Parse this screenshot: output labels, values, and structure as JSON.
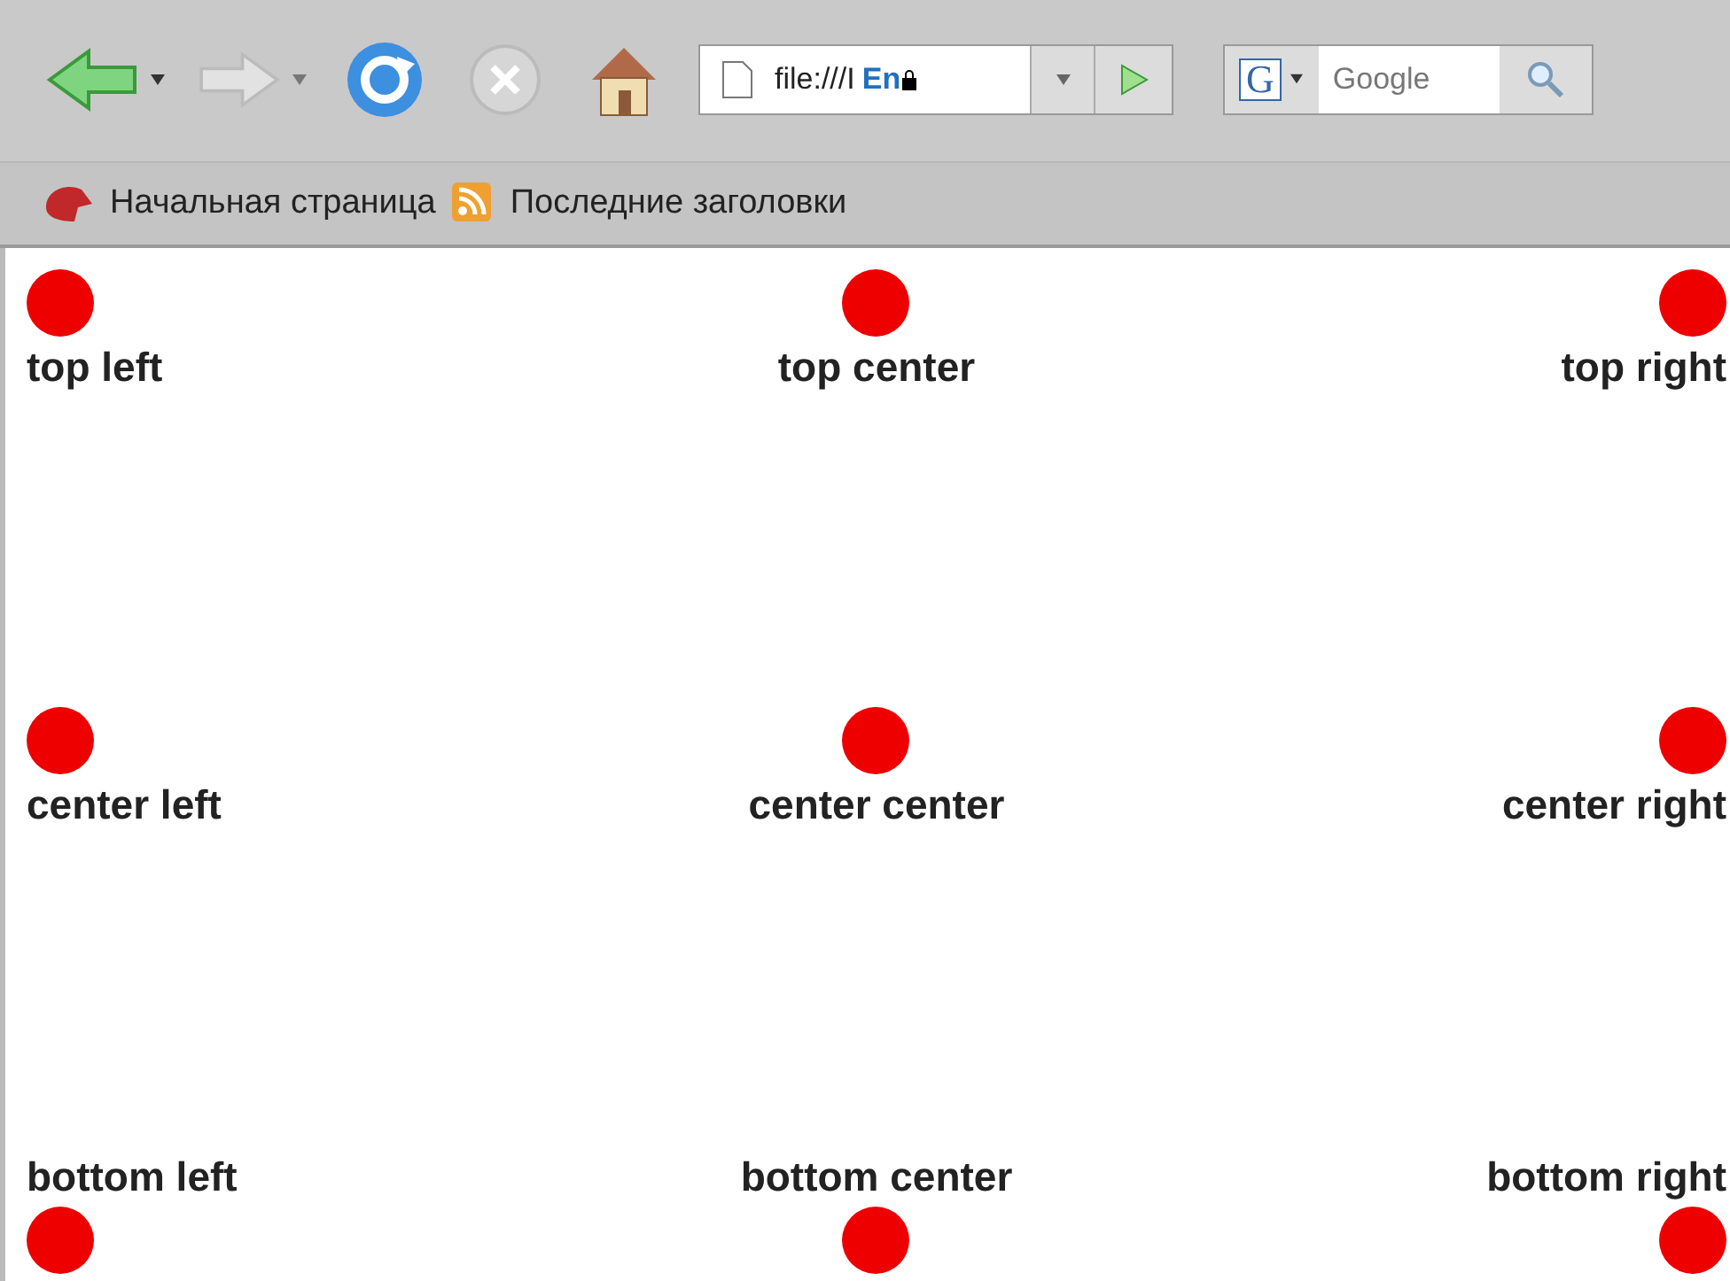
{
  "toolbar": {
    "url": "file:///I",
    "language": "En",
    "search_engine": "G",
    "search": {
      "placeholder": "Google"
    }
  },
  "bookmarks": [
    {
      "label": "Начальная страница",
      "kind": "home"
    },
    {
      "label": "Последние заголовки",
      "kind": "feed"
    }
  ],
  "rows": [
    {
      "kind": "dot-above",
      "cells": [
        {
          "label": "top left"
        },
        {
          "label": "top center"
        },
        {
          "label": "top right"
        }
      ]
    },
    {
      "kind": "dot-above",
      "cells": [
        {
          "label": "center left"
        },
        {
          "label": "center center"
        },
        {
          "label": "center right"
        }
      ]
    },
    {
      "kind": "dot-below",
      "cells": [
        {
          "label": "bottom left"
        },
        {
          "label": "bottom center"
        },
        {
          "label": "bottom right"
        }
      ]
    }
  ]
}
